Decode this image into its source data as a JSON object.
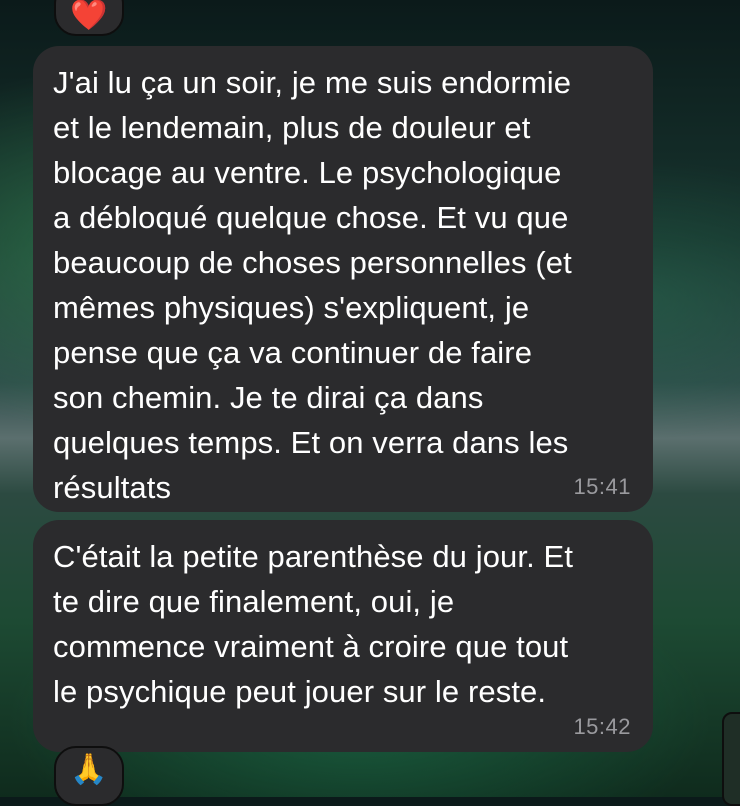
{
  "reactions": {
    "top": {
      "icon": "heart-icon",
      "glyph": "❤️",
      "color": "#e8182c"
    },
    "bottom": {
      "icon": "folded-hands-icon",
      "glyph": "🙏"
    }
  },
  "messages": [
    {
      "lines": [
        "J'ai lu ça un soir, je me suis endormie",
        "et le lendemain, plus de douleur et",
        "blocage au ventre. Le psychologique",
        "a débloqué quelque chose. Et vu que",
        "beaucoup de choses personnelles (et",
        "mêmes physiques) s'expliquent, je",
        "pense que ça va continuer de faire",
        "son chemin. Je te dirai ça dans",
        "quelques temps. Et on verra dans les",
        "résultats"
      ],
      "time": "15:41"
    },
    {
      "lines": [
        "C'était la petite parenthèse du jour. Et",
        "te dire que finalement, oui, je",
        "commence vraiment à croire que tout",
        "le psychique peut jouer sur le reste."
      ],
      "time": "15:42"
    }
  ],
  "colors": {
    "bubble": "#2b2b2d",
    "text": "#ffffff",
    "timestamp": "#9a9a9e"
  }
}
